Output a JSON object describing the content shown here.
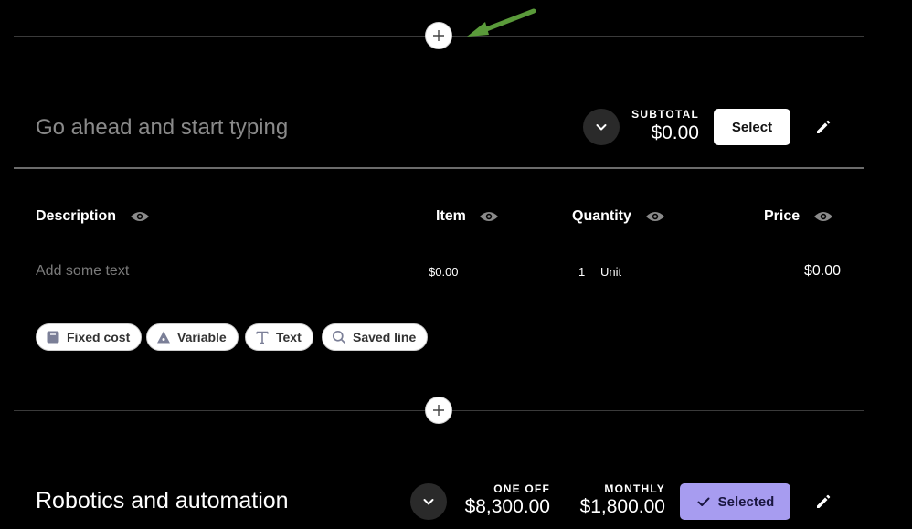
{
  "colors": {
    "background": "#000000",
    "selected_accent": "#a79cf0",
    "annotation_arrow": "#5a9a3a"
  },
  "section1": {
    "title_placeholder": "Go ahead and start typing",
    "subtotal_label": "SUBTOTAL",
    "subtotal_value": "$0.00",
    "select_label": "Select",
    "columns": {
      "description": "Description",
      "item": "Item",
      "quantity": "Quantity",
      "price": "Price"
    },
    "row": {
      "description_placeholder": "Add some text",
      "item_value": "$0.00",
      "quantity": "1",
      "unit": "Unit",
      "price": "$0.00"
    },
    "chips": {
      "fixed_cost": "Fixed cost",
      "variable": "Variable",
      "text": "Text",
      "saved_line": "Saved line"
    }
  },
  "section2": {
    "title": "Robotics and automation",
    "one_off_label": "ONE OFF",
    "one_off_value": "$8,300.00",
    "monthly_label": "MONTHLY",
    "monthly_value": "$1,800.00",
    "selected_label": "Selected"
  },
  "icons": {
    "add": "plus-icon",
    "collapse": "chevron-down-icon",
    "edit": "pencil-icon",
    "visibility": "eye-icon",
    "fixed_cost": "tag-icon",
    "variable": "triangle-icon",
    "text": "text-icon",
    "saved_line": "search-icon",
    "selected": "check-icon"
  }
}
